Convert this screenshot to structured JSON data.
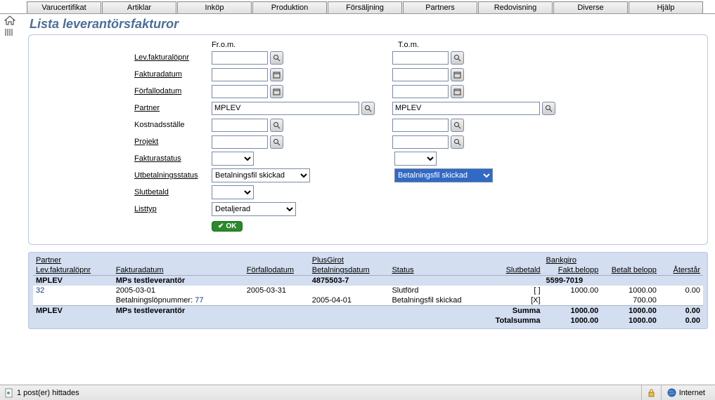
{
  "tabs": [
    "Varucertifikat",
    "Artiklar",
    "Inköp",
    "Produktion",
    "Försäljning",
    "Partners",
    "Redovisning",
    "Diverse",
    "Hjälp"
  ],
  "page_title": "Lista leverantörsfakturor",
  "filter": {
    "col_from": "Fr.o.m.",
    "col_to": "T.o.m.",
    "labels": {
      "levfakt": "Lev.fakturalöpnr",
      "fakturadatum": "Fakturadatum",
      "forfallodatum": "Förfallodatum",
      "partner": "Partner",
      "kostnadsstalle": "Kostnadsställe",
      "projekt": "Projekt",
      "fakturastatus": "Fakturastatus",
      "utbetalningsstatus": "Utbetalningsstatus",
      "slutbetald": "Slutbetald",
      "listtyp": "Listtyp"
    },
    "values": {
      "partner_from": "MPLEV",
      "partner_to": "MPLEV",
      "utbetalning_from": "Betalningsfil skickad",
      "utbetalning_to": "Betalningsfil skickad",
      "listtyp": "Detaljerad"
    },
    "ok_label": "OK"
  },
  "results": {
    "top_headers": {
      "partner": "Partner",
      "plusgirot": "PlusGirot",
      "bankgiro": "Bankgiro"
    },
    "headers": {
      "levfakt": "Lev.fakturalöpnr",
      "fakturadatum": "Fakturadatum",
      "forfallodatum": "Förfallodatum",
      "betalningsdatum": "Betalningsdatum",
      "status": "Status",
      "slutbetald": "Slutbetald",
      "faktbelopp": "Fakt.belopp",
      "betaltbelopp": "Betalt belopp",
      "aterstar": "Återstår"
    },
    "partner_row": {
      "code": "MPLEV",
      "name": "MPs testleverantör",
      "plusgirot": "4875503-7",
      "bankgiro": "5599-7019"
    },
    "data_row": {
      "levfakt": "32",
      "fakturadatum": "2005-03-01",
      "forfallodatum": "2005-03-31",
      "betalningsdatum": "",
      "status": "Slutförd",
      "slutbetald": "[  ]",
      "faktbelopp": "1000.00",
      "betaltbelopp": "1000.00",
      "aterstar": "0.00"
    },
    "betal_row": {
      "label": "Betalningslöpnummer:",
      "num": "77",
      "betalningsdatum": "2005-04-01",
      "status": "Betalningsfil skickad",
      "slutbetald": "[X]",
      "betaltbelopp": "700.00"
    },
    "summa_row": {
      "code": "MPLEV",
      "name": "MPs testleverantör",
      "label": "Summa",
      "faktbelopp": "1000.00",
      "betaltbelopp": "1000.00",
      "aterstar": "0.00"
    },
    "total_row": {
      "label": "Totalsumma",
      "faktbelopp": "1000.00",
      "betaltbelopp": "1000.00",
      "aterstar": "0.00"
    }
  },
  "statusbar": {
    "text": "1 post(er) hittades",
    "zone": "Internet"
  }
}
